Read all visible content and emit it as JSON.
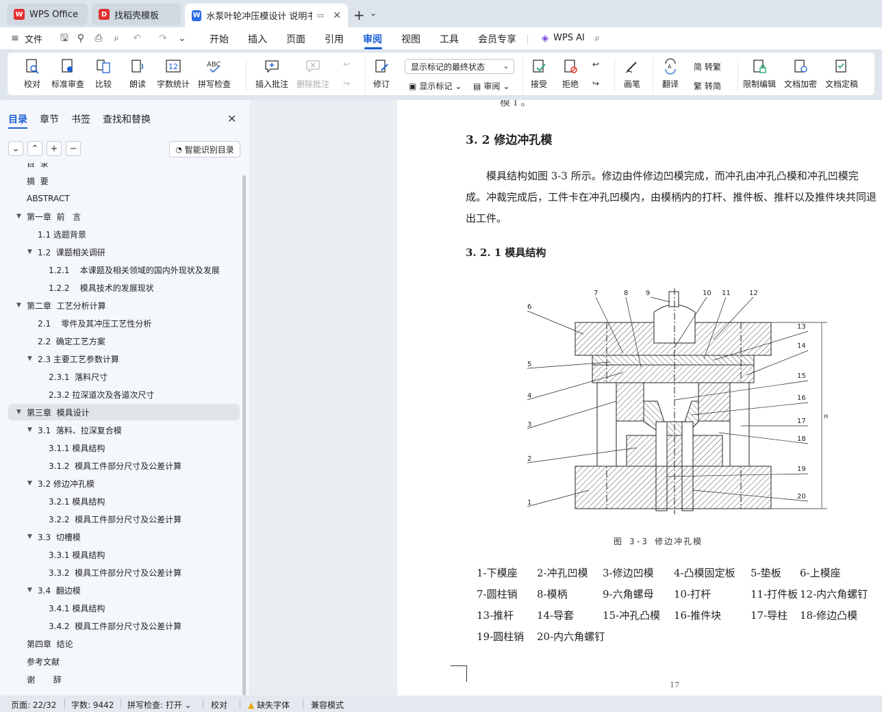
{
  "tabs": [
    {
      "label": "WPS Office",
      "icon": "wps-logo-icon",
      "color": "#e3302f"
    },
    {
      "label": "找稻壳模板",
      "icon": "docer-logo-icon",
      "color": "#e3302f"
    },
    {
      "label": "水泵叶轮冲压模设计 说明书（",
      "icon": "word-doc-icon",
      "color": "#2b6be8"
    }
  ],
  "menu": {
    "file": "文件",
    "items": [
      "开始",
      "插入",
      "页面",
      "引用",
      "审阅",
      "视图",
      "工具",
      "会员专享"
    ],
    "active": "审阅",
    "ai": "WPS AI"
  },
  "ribbon": {
    "proofread": "校对",
    "standard_review": "标准审查",
    "compare": "比较",
    "read_aloud": "朗读",
    "word_count": "字数统计",
    "spell_check": "拼写检查",
    "insert_comment": "插入批注",
    "delete_comment": "删除批注",
    "revise": "修订",
    "display_state": "显示标记的最终状态",
    "show_markup": "显示标记",
    "review": "审阅",
    "accept": "接受",
    "reject": "拒绝",
    "pen": "画笔",
    "translate": "翻译",
    "to_traditional": "转繁",
    "to_simplified": "转简",
    "restrict_edit": "限制编辑",
    "encrypt": "文档加密",
    "finalize": "文档定稿"
  },
  "left_pane": {
    "tabs": [
      "目录",
      "章节",
      "书签",
      "查找和替换"
    ],
    "smart_toc": "智能识别目录",
    "toc": [
      {
        "label": "目  录",
        "level": 1,
        "arrow": false
      },
      {
        "label": "摘  要",
        "level": 1,
        "arrow": false
      },
      {
        "label": "ABSTRACT",
        "level": 1,
        "arrow": false
      },
      {
        "label": "第一章  前   言",
        "level": 1,
        "arrow": true
      },
      {
        "label": "1.1 选题背景",
        "level": 2,
        "arrow": false
      },
      {
        "label": "1.2  课题相关调研",
        "level": 2,
        "arrow": true
      },
      {
        "label": "1.2.1    本课题及相关领域的国内外现状及发展",
        "level": 3,
        "arrow": false
      },
      {
        "label": "1.2.2    模具技术的发展现状",
        "level": 3,
        "arrow": false
      },
      {
        "label": "第二章  工艺分析计算",
        "level": 1,
        "arrow": true
      },
      {
        "label": "2.1    零件及其冲压工艺性分析",
        "level": 2,
        "arrow": false
      },
      {
        "label": "2.2  确定工艺方案",
        "level": 2,
        "arrow": false
      },
      {
        "label": "2.3 主要工艺参数计算",
        "level": 2,
        "arrow": true
      },
      {
        "label": "2.3.1  落料尺寸",
        "level": 3,
        "arrow": false
      },
      {
        "label": "2.3.2 拉深道次及各道次尺寸",
        "level": 3,
        "arrow": false
      },
      {
        "label": "第三章  模具设计",
        "level": 1,
        "arrow": true,
        "selected": true
      },
      {
        "label": "3.1  落料、拉深复合模",
        "level": 2,
        "arrow": true
      },
      {
        "label": "3.1.1 模具结构",
        "level": 3,
        "arrow": false
      },
      {
        "label": "3.1.2  模具工件部分尺寸及公差计算",
        "level": 3,
        "arrow": false
      },
      {
        "label": "3.2 修边冲孔模",
        "level": 2,
        "arrow": true
      },
      {
        "label": "3.2.1 模具结构",
        "level": 3,
        "arrow": false
      },
      {
        "label": "3.2.2  模具工件部分尺寸及公差计算",
        "level": 3,
        "arrow": false
      },
      {
        "label": "3.3  切槽模",
        "level": 2,
        "arrow": true
      },
      {
        "label": "3.3.1 模具结构",
        "level": 3,
        "arrow": false
      },
      {
        "label": "3.3.2  模具工件部分尺寸及公差计算",
        "level": 3,
        "arrow": false
      },
      {
        "label": "3.4  翻边模",
        "level": 2,
        "arrow": true
      },
      {
        "label": "3.4.1 模具结构",
        "level": 3,
        "arrow": false
      },
      {
        "label": "3.4.2  模具工件部分尺寸及公差计算",
        "level": 3,
        "arrow": false
      },
      {
        "label": "第四章  结论",
        "level": 1,
        "arrow": false
      },
      {
        "label": "参考文献",
        "level": 1,
        "arrow": false
      },
      {
        "label": "谢       辞",
        "level": 1,
        "arrow": false
      }
    ]
  },
  "document": {
    "top_fragment": "模  Ⅰ              。",
    "heading": "3. 2 修边冲孔模",
    "paragraph": "模具结构如图 3-3 所示。修边由件修边凹模完成，而冲孔由冲孔凸模和冲孔凹模完成。冲裁完成后，工件卡在冲孔凹模内，由模柄内的打杆、推件板、推杆以及推件块共同退出工件。",
    "subheading": "3. 2. 1 模具结构",
    "caption": "图 3-3  修边冲孔模",
    "legend": [
      [
        "1-下模座",
        "2-冲孔凹模",
        "3-修边凹模",
        "4-凸模固定板",
        "5-垫板",
        "6-上模座"
      ],
      [
        "7-圆柱销",
        "8-模柄",
        "9-六角螺母",
        "10-打杆",
        "11-打件板",
        "12-内六角螺钉"
      ],
      [
        "13-推杆",
        "14-导套",
        "15-冲孔凸模",
        "16-推件块",
        "17-导柱",
        "18-修边凸模"
      ],
      [
        "19-圆柱销",
        "20-内六角螺钉"
      ]
    ],
    "drawing_labels_left": [
      "6",
      "5",
      "4",
      "3",
      "2",
      "1"
    ],
    "drawing_labels_top": [
      "7",
      "8",
      "9",
      "10",
      "11",
      "12"
    ],
    "drawing_labels_right": [
      "13",
      "14",
      "15",
      "16",
      "17",
      "18",
      "19",
      "20"
    ],
    "dimension_label": "H",
    "page_number": "17"
  },
  "status": {
    "page": "页面: 22/32",
    "words": "字数: 9442",
    "spell": "拼写检查: 打开",
    "proof": "校对",
    "missing_font": "缺失字体",
    "compat": "兼容模式"
  }
}
